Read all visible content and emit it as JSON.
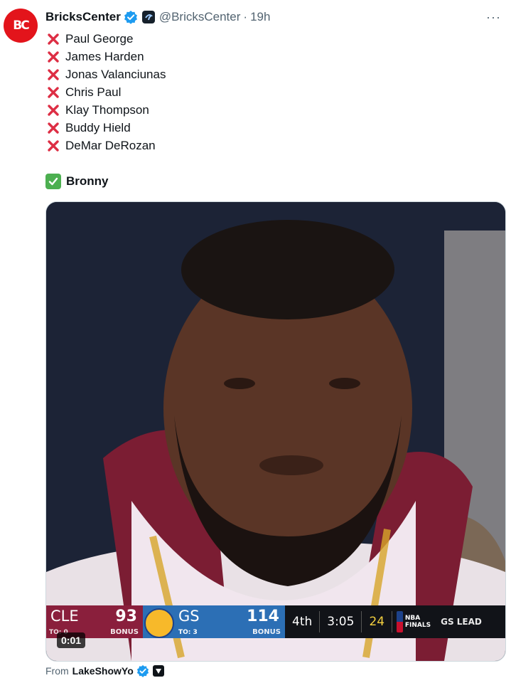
{
  "author": {
    "avatar_text": "BC",
    "display_name": "BricksCenter",
    "handle": "@BricksCenter",
    "separator": "·",
    "time": "19h"
  },
  "more_menu": "···",
  "tweet_lines": [
    "Paul George",
    "James Harden",
    "Jonas Valanciunas",
    "Chris Paul",
    "Klay Thompson",
    "Buddy Hield",
    "DeMar DeRozan"
  ],
  "check_line": "Bronny",
  "media": {
    "timer": "0:01",
    "scorebug": {
      "team1_abbr": "CLE",
      "team1_score": "93",
      "team1_sub": "TO: 0",
      "team1_bonus": "BONUS",
      "team2_abbr": "GS",
      "team2_score": "114",
      "team2_sub": "TO: 3",
      "team2_bonus": "BONUS",
      "quarter": "4th",
      "clock": "3:05",
      "shot_clock": "24",
      "logo_text_1": "NBA",
      "logo_text_2": "FINALS",
      "lead_text": "GS LEAD"
    }
  },
  "from": {
    "label": "From",
    "name": "LakeShowYo"
  },
  "colors": {
    "accent_red": "#e3141b",
    "verified_blue": "#1d9bf0",
    "cross_red": "#dd2e44",
    "check_green": "#4caf50"
  }
}
